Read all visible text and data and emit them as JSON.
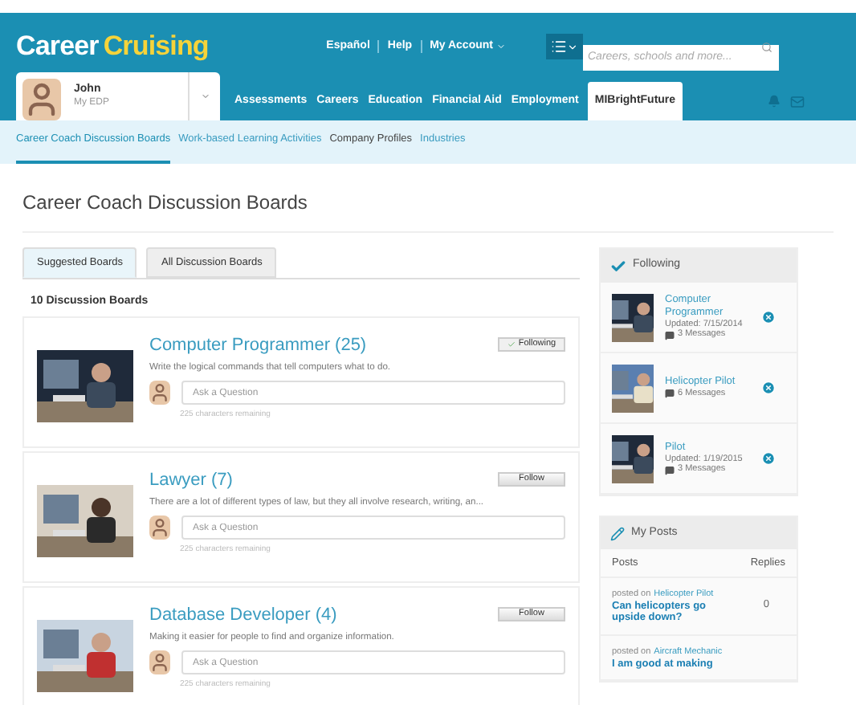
{
  "header": {
    "logo_first": "Career",
    "logo_second": "Cruising",
    "links": [
      "Español",
      "Help",
      "My Account"
    ],
    "search": {
      "placeholder": "Careers, schools and more..."
    }
  },
  "user": {
    "name": "John",
    "subtitle": "My EDP"
  },
  "nav": [
    {
      "label": "Assessments",
      "selected": false
    },
    {
      "label": "Careers",
      "selected": false
    },
    {
      "label": "Education",
      "selected": false
    },
    {
      "label": "Financial Aid",
      "selected": false
    },
    {
      "label": "Employment",
      "selected": false
    },
    {
      "label": "MIBrightFuture",
      "selected": true
    }
  ],
  "subnav": [
    {
      "label": "Career Coach Discussion Boards",
      "selected": true
    },
    {
      "label": "Work-based Learning Activities",
      "selected": false
    },
    {
      "label": "Company Profiles",
      "selected": false
    },
    {
      "label": "Industries",
      "selected": false
    }
  ],
  "page_title": "Career Coach Discussion Boards",
  "tabs": [
    {
      "label": "Suggested Boards",
      "selected": true
    },
    {
      "label": "All Discussion Boards",
      "selected": false
    }
  ],
  "board_count": "10 Discussion Boards",
  "boards": [
    {
      "title": "Computer Programmer (25)",
      "description": "Write the logical commands that tell computers what to do.",
      "following": true,
      "button": "Following",
      "placeholder": "Ask a Question",
      "remaining": "225 characters remaining"
    },
    {
      "title": "Lawyer (7)",
      "description": "There are a lot of different types of law, but they all involve research, writing, an...",
      "following": false,
      "button": "Follow",
      "placeholder": "Ask a Question",
      "remaining": "225 characters remaining"
    },
    {
      "title": "Database Developer (4)",
      "description": "Making it easier for people to find and organize information.",
      "following": false,
      "button": "Follow",
      "placeholder": "Ask a Question",
      "remaining": "225 characters remaining"
    }
  ],
  "following": {
    "title": "Following",
    "items": [
      {
        "title": "Computer Programmer",
        "updated": "Updated: 7/15/2014",
        "messages": "3 Messages"
      },
      {
        "title": "Helicopter Pilot",
        "messages": "6 Messages"
      },
      {
        "title": "Pilot",
        "updated": "Updated: 1/19/2015",
        "messages": "3 Messages"
      }
    ]
  },
  "my_posts": {
    "title": "My Posts",
    "columns": [
      "Posts",
      "Replies"
    ],
    "rows": [
      {
        "posted_on": "posted on",
        "board": "Helicopter Pilot",
        "question": "Can helicopters go upside down?",
        "replies": "0"
      },
      {
        "posted_on": "posted on",
        "board": "Aircraft Mechanic",
        "question": "I am good at making"
      }
    ]
  }
}
